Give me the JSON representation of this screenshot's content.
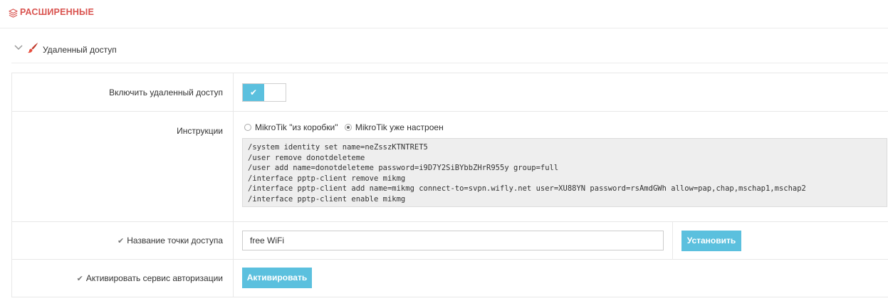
{
  "header": {
    "title": "РАСШИРЕННЫЕ",
    "icon": "layers-icon",
    "accent": "#d9534f"
  },
  "section": {
    "label": "Удаленный доступ",
    "icon": "brush-icon"
  },
  "rows": {
    "remote_access": {
      "label": "Включить удаленный доступ",
      "toggle_on": true
    },
    "instructions": {
      "label": "Инструкции",
      "options": [
        "MikroTik \"из коробки\"",
        "MikroTik уже настроен"
      ],
      "selected": "MikroTik уже настроен",
      "code": "/system identity set name=neZsszKTNTRET5\n/user remove donotdeleteme\n/user add name=donotdeleteme password=i9D7Y2SiBYbbZHrR955y group=full\n/interface pptp-client remove mikmg\n/interface pptp-client add name=mikmg connect-to=svpn.wifly.net user=XU88YN password=rsAmdGWh allow=pap,chap,mschap1,mschap2\n/interface pptp-client enable mikmg"
    },
    "ap_name": {
      "label": "Название точки доступа",
      "value": "free WiFi",
      "button": "Установить"
    },
    "auth_service": {
      "label": "Активировать сервис авторизации",
      "button": "Активировать"
    }
  },
  "colors": {
    "button": "#5bc0de",
    "toggle_on": "#5bc0de"
  }
}
